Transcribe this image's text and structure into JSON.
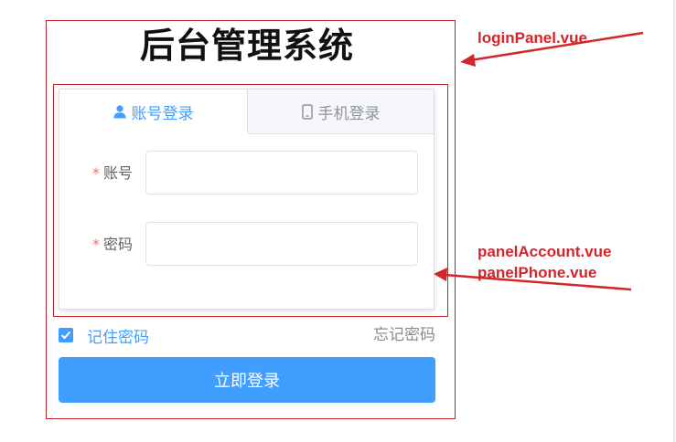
{
  "title": "后台管理系统",
  "tabs": [
    {
      "label": "账号登录",
      "icon": "user-icon",
      "active": true
    },
    {
      "label": "手机登录",
      "icon": "mobile-phone-icon",
      "active": false
    }
  ],
  "form": {
    "account": {
      "required_mark": "*",
      "label": "账号",
      "value": ""
    },
    "password": {
      "required_mark": "*",
      "label": "密码",
      "value": ""
    }
  },
  "remember": {
    "label": "记住密码",
    "checked": true
  },
  "forgot_label": "忘记密码",
  "login_button_label": "立即登录",
  "annotations": {
    "outer": "loginPanel.vue",
    "inner_line1": "panelAccount.vue",
    "inner_line2": "panelPhone.vue"
  },
  "colors": {
    "primary": "#409eff",
    "annotation": "#d3252a",
    "required": "#f56c6c"
  }
}
